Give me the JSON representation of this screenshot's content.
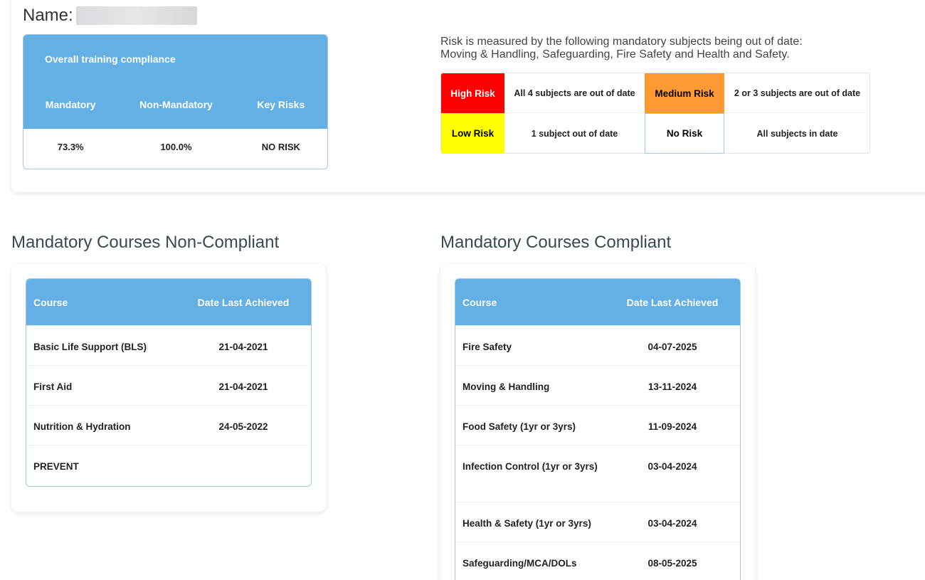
{
  "header": {
    "name_label": "Name:"
  },
  "overall": {
    "title": "Overall training compliance",
    "columns": [
      "Mandatory",
      "Non-Mandatory",
      "Key Risks"
    ],
    "values": [
      "73.3%",
      "100.0%",
      "NO RISK"
    ]
  },
  "risk": {
    "line1": "Risk is measured by the following mandatory subjects being out of date:",
    "line2": "Moving & Handling, Safeguarding, Fire Safety and Health and Safety.",
    "levels": [
      {
        "label": "High Risk",
        "desc": "All 4 subjects are out of date",
        "color": "#ff0000",
        "text_color": "#ffffff"
      },
      {
        "label": "Medium Risk",
        "desc": "2 or 3 subjects are out of date",
        "color": "#ff9933",
        "text_color": "#000000"
      },
      {
        "label": "Low Risk",
        "desc": "1 subject out of date",
        "color": "#ffff00",
        "text_color": "#000000"
      },
      {
        "label": "No Risk",
        "desc": "All subjects in date",
        "color": "#ffffff",
        "text_color": "#000000"
      }
    ]
  },
  "non_compliant": {
    "title": "Mandatory Courses Non-Compliant",
    "columns": [
      "Course",
      "Date Last Achieved"
    ],
    "rows": [
      {
        "course": "Basic Life Support (BLS)",
        "date": "21-04-2021"
      },
      {
        "course": "First Aid",
        "date": "21-04-2021"
      },
      {
        "course": "Nutrition & Hydration",
        "date": "24-05-2022"
      },
      {
        "course": "PREVENT",
        "date": ""
      }
    ]
  },
  "compliant": {
    "title": "Mandatory Courses Compliant",
    "columns": [
      "Course",
      "Date Last Achieved"
    ],
    "rows": [
      {
        "course": "Fire Safety",
        "date": "04-07-2025"
      },
      {
        "course": "Moving & Handling",
        "date": "13-11-2024"
      },
      {
        "course": "Food Safety (1yr or 3yrs)",
        "date": "11-09-2024"
      },
      {
        "course": "Infection Control (1yr or 3yrs)",
        "date": "03-04-2024"
      },
      {
        "course": "Health & Safety (1yr or 3yrs)",
        "date": "03-04-2024"
      },
      {
        "course": "Safeguarding/MCA/DOLs",
        "date": "08-05-2025"
      }
    ]
  }
}
